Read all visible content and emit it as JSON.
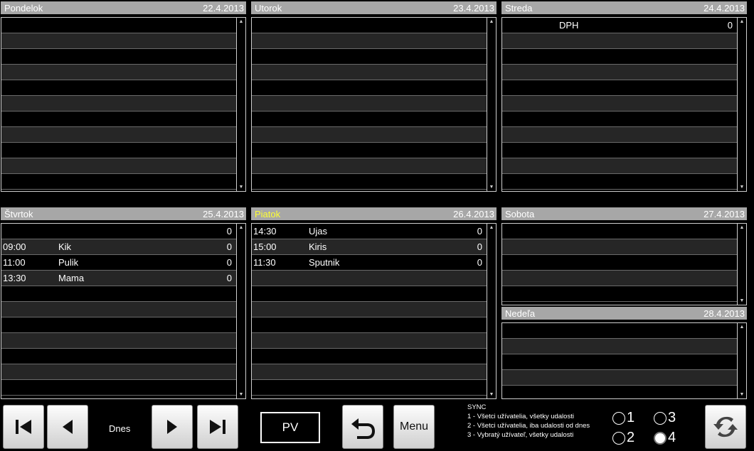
{
  "days": [
    {
      "name": "Pondelok",
      "date": "22.4.2013",
      "today": false,
      "rows": []
    },
    {
      "name": "Utorok",
      "date": "23.4.2013",
      "today": false,
      "rows": []
    },
    {
      "name": "Streda",
      "date": "24.4.2013",
      "today": false,
      "rows": [
        {
          "time": "",
          "title": "DPH",
          "value": "0"
        }
      ]
    },
    {
      "name": "Štvrtok",
      "date": "25.4.2013",
      "today": false,
      "rows": [
        {
          "time": "",
          "title": "",
          "value": "0"
        },
        {
          "time": "09:00",
          "title": "Kik",
          "value": "0"
        },
        {
          "time": "11:00",
          "title": "Pulik",
          "value": "0"
        },
        {
          "time": "13:30",
          "title": "Mama",
          "value": "0"
        }
      ]
    },
    {
      "name": "Piatok",
      "date": "26.4.2013",
      "today": true,
      "rows": [
        {
          "time": "14:30",
          "title": "Ujas",
          "value": "0"
        },
        {
          "time": "15:00",
          "title": "Kiris",
          "value": "0"
        },
        {
          "time": "11:30",
          "title": "Sputnik",
          "value": "0"
        }
      ]
    },
    {
      "name": "Sobota",
      "date": "27.4.2013",
      "today": false,
      "rows": []
    },
    {
      "name": "Nedeľa",
      "date": "28.4.2013",
      "today": false,
      "rows": []
    }
  ],
  "toolbar": {
    "today_label": "Dnes",
    "pv_label": "PV",
    "menu_label": "Menu",
    "sync_title": "SYNC",
    "sync_options": [
      "1 - Všetci užívatelia, všetky udalosti",
      "2 - Všetci užívatelia, iba udalosti od dnes",
      "3 - Vybratý užívateľ, všetky udalosti"
    ],
    "radio_labels": [
      "1",
      "2",
      "3",
      "4"
    ],
    "radio_selected": "4"
  },
  "icons": {
    "first": "skip-first-icon",
    "prev": "prev-icon",
    "next": "next-icon",
    "last": "skip-last-icon",
    "undo": "undo-arrow-icon",
    "sync": "sync-icon"
  }
}
